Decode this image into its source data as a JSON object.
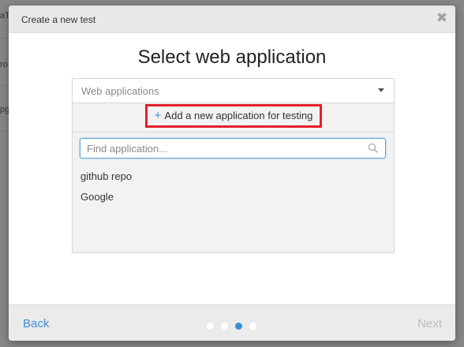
{
  "background": {
    "fragments": [
      "aT",
      "ro",
      "pg"
    ]
  },
  "modal": {
    "title": "Create a new test",
    "close_glyph": "✖",
    "heading": "Select web application"
  },
  "panel": {
    "select_value": "Web applications",
    "add_link_plus": "+",
    "add_link_label": "Add a new application for testing",
    "search_placeholder": "Find application...",
    "applications": [
      "github repo",
      "Google"
    ]
  },
  "footer": {
    "back_label": "Back",
    "next_label": "Next",
    "steps_total": 4,
    "active_step": 3
  },
  "colors": {
    "accent": "#3a8fd6",
    "highlight_border": "#e3202a",
    "disabled_text": "#bcbcbc"
  },
  "icons": [
    "close-icon",
    "chevron-down-icon",
    "plus-icon",
    "search-icon"
  ]
}
